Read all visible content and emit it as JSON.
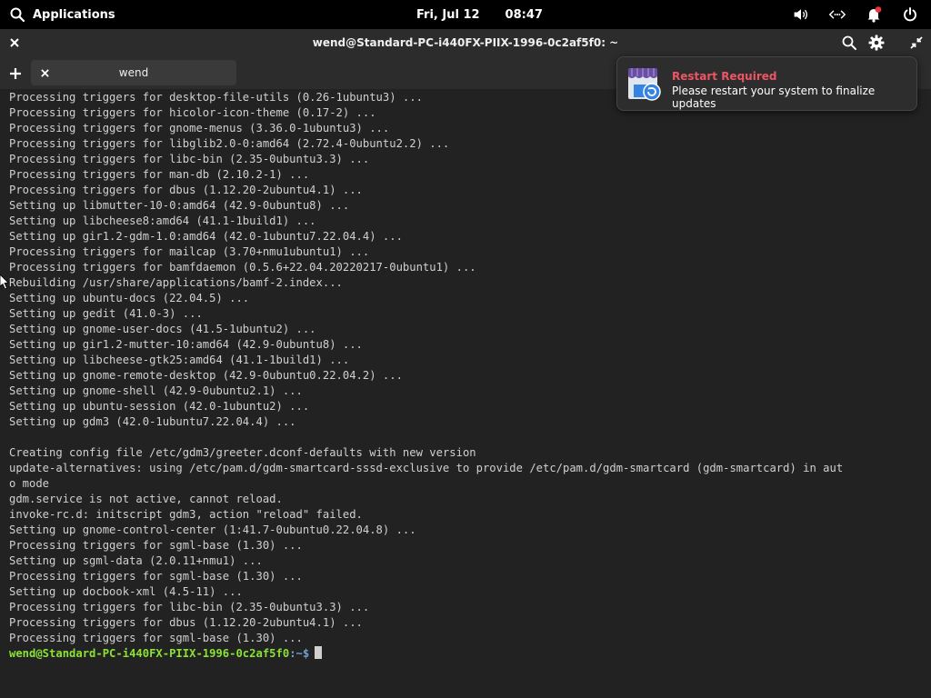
{
  "topbar": {
    "apps_label": "Applications",
    "date": "Fri, Jul 12",
    "time": "08:47"
  },
  "window": {
    "title": "wend@Standard-PC-i440FX-PIIX-1996-0c2af5f0: ~"
  },
  "tabs": [
    {
      "label": "wend"
    }
  ],
  "notification": {
    "title": "Restart Required",
    "body": "Please restart your system to finalize updates"
  },
  "terminal": {
    "lines": [
      "Processing triggers for desktop-file-utils (0.26-1ubuntu3) ...",
      "Processing triggers for hicolor-icon-theme (0.17-2) ...",
      "Processing triggers for gnome-menus (3.36.0-1ubuntu3) ...",
      "Processing triggers for libglib2.0-0:amd64 (2.72.4-0ubuntu2.2) ...",
      "Processing triggers for libc-bin (2.35-0ubuntu3.3) ...",
      "Processing triggers for man-db (2.10.2-1) ...",
      "Processing triggers for dbus (1.12.20-2ubuntu4.1) ...",
      "Setting up libmutter-10-0:amd64 (42.9-0ubuntu8) ...",
      "Setting up libcheese8:amd64 (41.1-1build1) ...",
      "Setting up gir1.2-gdm-1.0:amd64 (42.0-1ubuntu7.22.04.4) ...",
      "Processing triggers for mailcap (3.70+nmu1ubuntu1) ...",
      "Processing triggers for bamfdaemon (0.5.6+22.04.20220217-0ubuntu1) ...",
      "Rebuilding /usr/share/applications/bamf-2.index...",
      "Setting up ubuntu-docs (22.04.5) ...",
      "Setting up gedit (41.0-3) ...",
      "Setting up gnome-user-docs (41.5-1ubuntu2) ...",
      "Setting up gir1.2-mutter-10:amd64 (42.9-0ubuntu8) ...",
      "Setting up libcheese-gtk25:amd64 (41.1-1build1) ...",
      "Setting up gnome-remote-desktop (42.9-0ubuntu0.22.04.2) ...",
      "Setting up gnome-shell (42.9-0ubuntu2.1) ...",
      "Setting up ubuntu-session (42.0-1ubuntu2) ...",
      "Setting up gdm3 (42.0-1ubuntu7.22.04.4) ...",
      "",
      "Creating config file /etc/gdm3/greeter.dconf-defaults with new version",
      "update-alternatives: using /etc/pam.d/gdm-smartcard-sssd-exclusive to provide /etc/pam.d/gdm-smartcard (gdm-smartcard) in aut",
      "o mode",
      "gdm.service is not active, cannot reload.",
      "invoke-rc.d: initscript gdm3, action \"reload\" failed.",
      "Setting up gnome-control-center (1:41.7-0ubuntu0.22.04.8) ...",
      "Processing triggers for sgml-base (1.30) ...",
      "Setting up sgml-data (2.0.11+nmu1) ...",
      "Processing triggers for sgml-base (1.30) ...",
      "Setting up docbook-xml (4.5-11) ...",
      "Processing triggers for libc-bin (2.35-0ubuntu3.3) ...",
      "Processing triggers for dbus (1.12.20-2ubuntu4.1) ...",
      "Processing triggers for sgml-base (1.30) ..."
    ],
    "prompt_user": "wend@Standard-PC-i440FX-PIIX-1996-0c2af5f0",
    "prompt_path": ":~$"
  }
}
